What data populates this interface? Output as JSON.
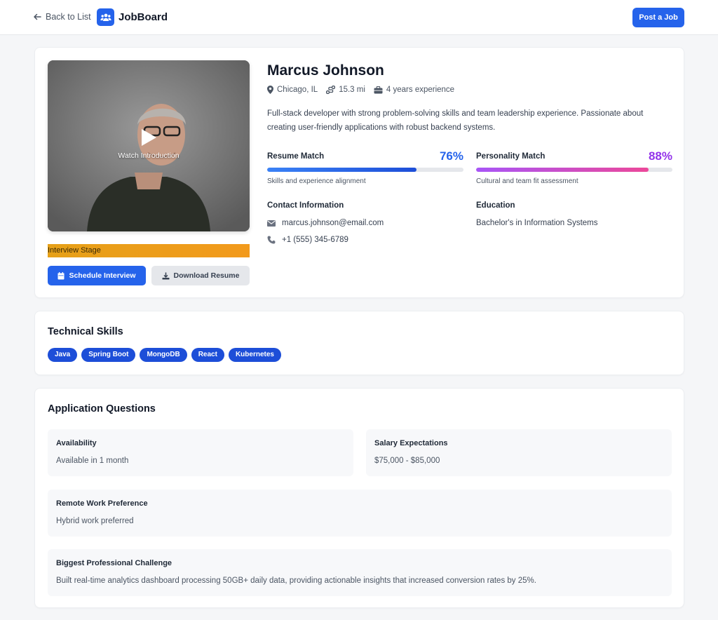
{
  "header": {
    "back_label": "Back to List",
    "brand_name": "JobBoard",
    "post_button": "Post a Job"
  },
  "candidate": {
    "name": "Marcus Johnson",
    "location": "Chicago, IL",
    "distance": "15.3 mi",
    "experience": "4 years experience",
    "summary": "Full-stack developer with strong problem-solving skills and team leadership experience. Passionate about creating user-friendly applications with robust backend systems."
  },
  "video": {
    "label": "Watch Introduction"
  },
  "stage": {
    "label": "Interview Stage"
  },
  "actions": {
    "schedule_label": "Schedule Interview",
    "download_label": "Download Resume"
  },
  "matches": {
    "resume": {
      "label": "Resume Match",
      "value": "76%",
      "percent": 76,
      "caption": "Skills and experience alignment",
      "color": "#2563eb"
    },
    "personality": {
      "label": "Personality Match",
      "value": "88%",
      "percent": 88,
      "caption": "Cultural and team fit assessment",
      "color": "#9333ea"
    }
  },
  "contact": {
    "title": "Contact Information",
    "email": "marcus.johnson@email.com",
    "phone": "+1 (555) 345-6789"
  },
  "education": {
    "title": "Education",
    "value": "Bachelor's in Information Systems"
  },
  "skills": {
    "title": "Technical Skills",
    "items": [
      "Java",
      "Spring Boot",
      "MongoDB",
      "React",
      "Kubernetes"
    ]
  },
  "questions": {
    "title": "Application Questions",
    "items": [
      {
        "title": "Availability",
        "value": "Available in 1 month"
      },
      {
        "title": "Salary Expectations",
        "value": "$75,000 - $85,000"
      },
      {
        "title": "Remote Work Preference",
        "value": "Hybrid work preferred"
      },
      {
        "title": "Biggest Professional Challenge",
        "value": "Built real-time analytics dashboard processing 50GB+ daily data, providing actionable insights that increased conversion rates by 25%."
      }
    ]
  },
  "colors": {
    "primary": "#2563eb",
    "stage": "#f29a1c",
    "resume_accent": "#2563eb",
    "personality_accent": "#9333ea"
  },
  "icons": {
    "back": "arrow-left-icon",
    "brand": "users-icon",
    "location": "map-pin-icon",
    "distance": "route-icon",
    "experience": "briefcase-icon",
    "play": "play-icon",
    "schedule": "calendar-icon",
    "download": "download-icon",
    "email": "envelope-icon",
    "phone": "phone-icon"
  }
}
